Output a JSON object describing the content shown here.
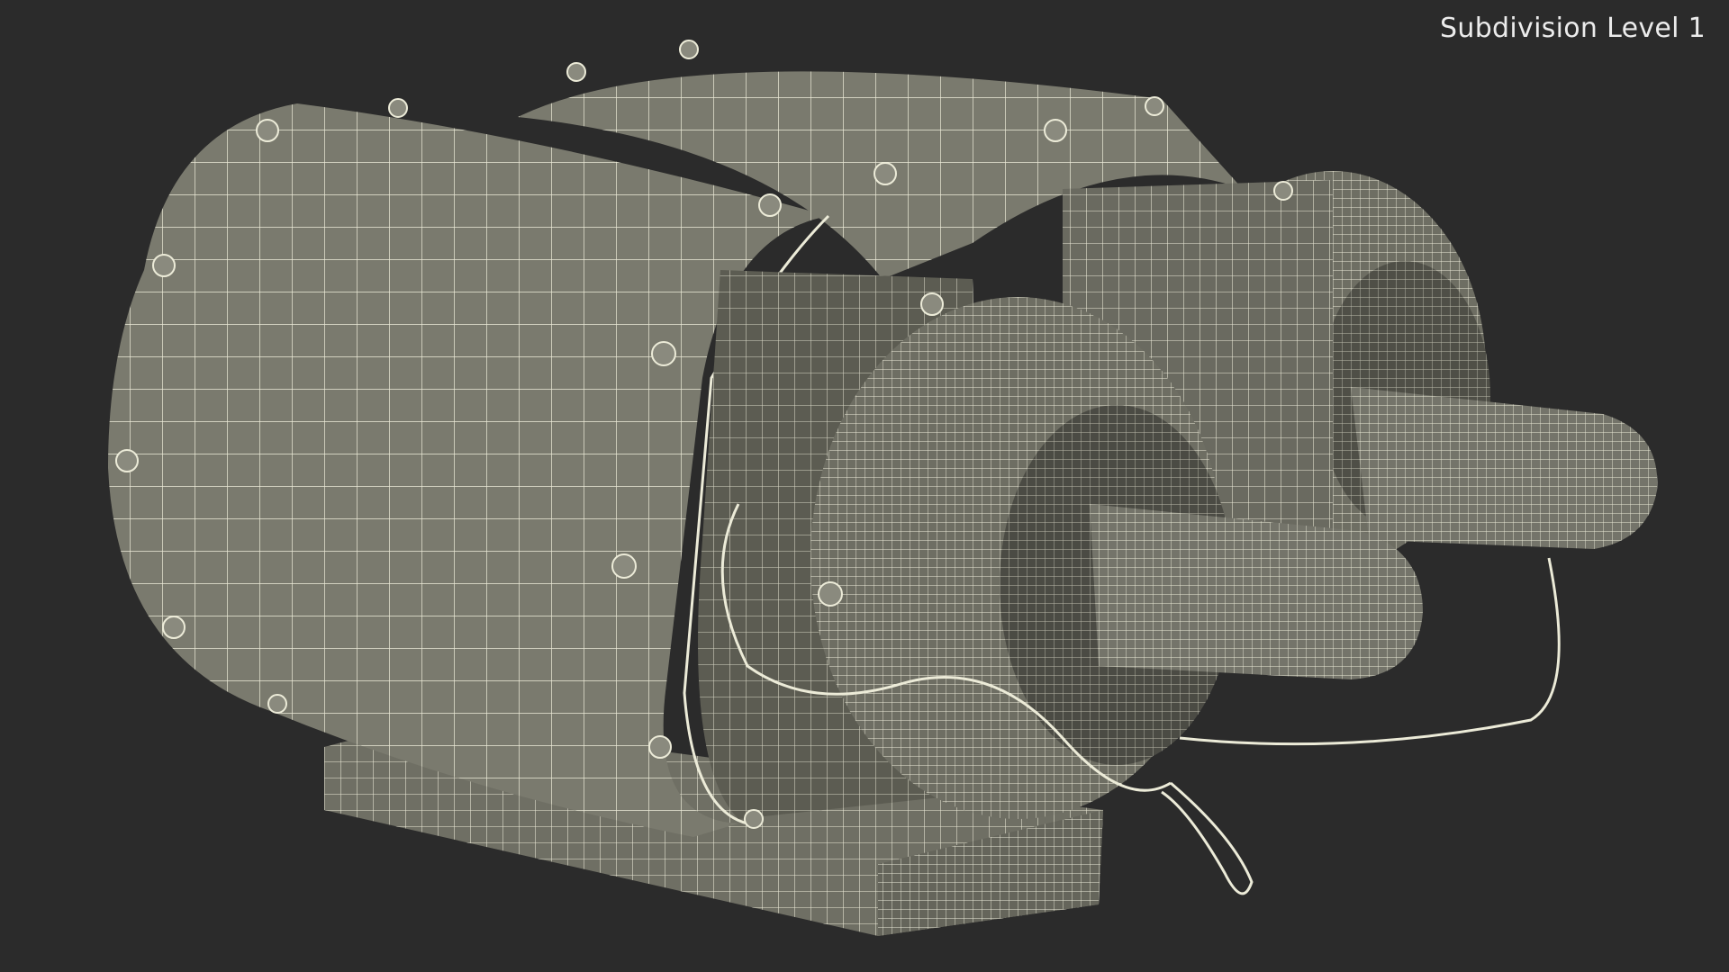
{
  "viewport": {
    "label": "Subdivision Level 1",
    "background": "#2b2b2b",
    "mesh_fill": "#7a7a6e",
    "mesh_fill_dark": "#5c5c52",
    "wire_color": "#ecebd8"
  },
  "model": {
    "icon": "jet-engine-wireframe-icon"
  }
}
